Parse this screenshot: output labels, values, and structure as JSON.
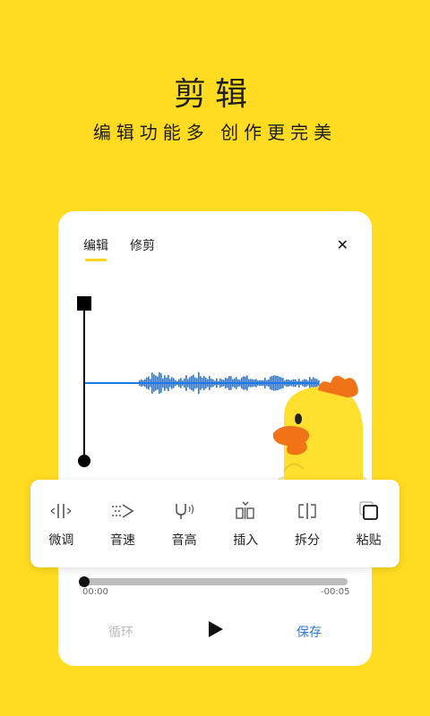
{
  "hero": {
    "title": "剪辑",
    "subtitle": "编辑功能多  创作更完美"
  },
  "card": {
    "tabs": [
      {
        "label": "编辑",
        "active": true
      },
      {
        "label": "修剪",
        "active": false
      }
    ],
    "close_icon": "close-icon"
  },
  "toolbar": {
    "items": [
      {
        "label": "微调",
        "icon": "fine-tune-icon"
      },
      {
        "label": "音速",
        "icon": "speed-icon"
      },
      {
        "label": "音高",
        "icon": "pitch-icon"
      },
      {
        "label": "插入",
        "icon": "insert-icon"
      },
      {
        "label": "拆分",
        "icon": "split-icon"
      },
      {
        "label": "粘贴",
        "icon": "paste-icon"
      }
    ]
  },
  "player": {
    "time_current": "00:00",
    "time_remaining": "-00:05",
    "progress": 0,
    "loop_label": "循环",
    "save_label": "保存"
  },
  "colors": {
    "background": "#FFDC22",
    "waveform": "#1E78E6",
    "accent": "#FFD21F",
    "save": "#2B7BD6"
  }
}
